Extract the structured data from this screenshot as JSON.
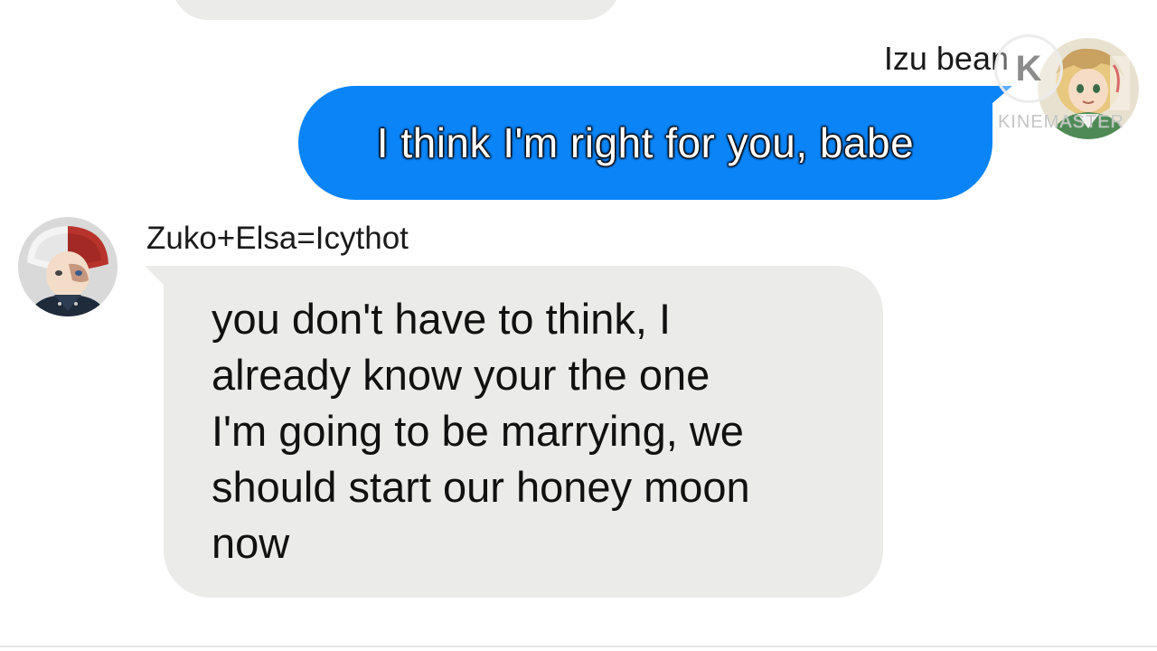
{
  "sent_message": {
    "sender_name": "Izu bean",
    "text": "I think I'm right for you, babe",
    "bubble_color": "#0a84f7"
  },
  "received_message": {
    "sender_name": "Zuko+Elsa=Icythot",
    "text": "you don't have to think, I\nalready know your the one\nI'm going to be marrying, we\nshould start our honey moon\nnow",
    "bubble_color": "#ebecea"
  },
  "watermark": {
    "logo_letter": "K",
    "text": "KINEMASTER"
  },
  "icons": {
    "sender_avatar": "avatar-izu-bean-icon",
    "receiver_avatar": "avatar-zuko-elsa-icon"
  }
}
